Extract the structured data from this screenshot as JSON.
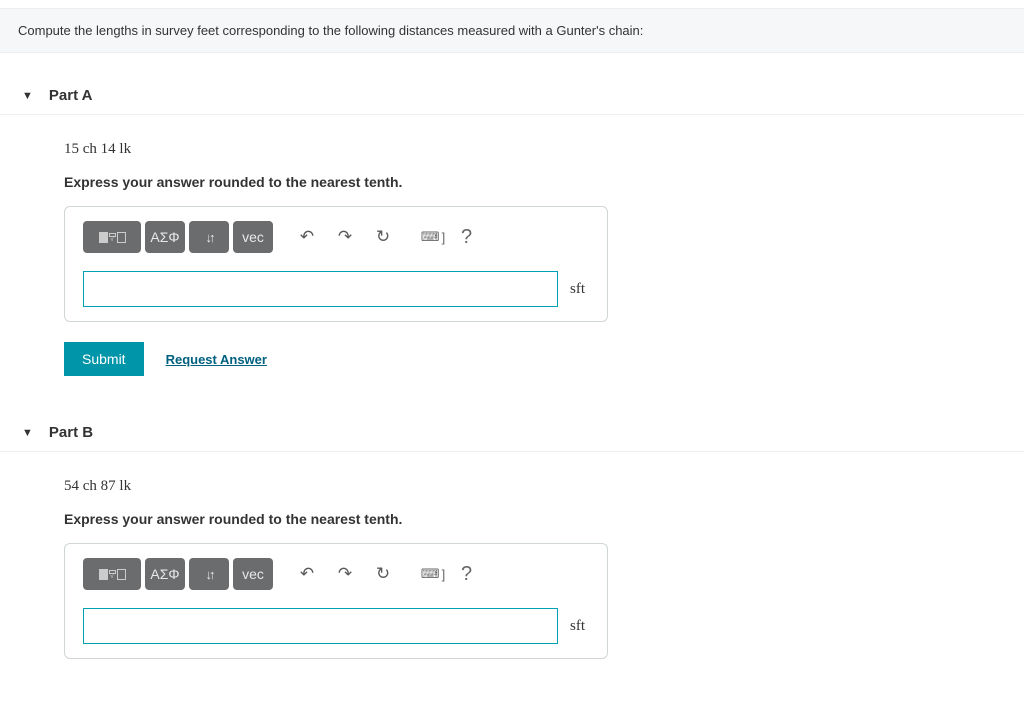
{
  "question": "Compute the lengths in survey feet corresponding to the following distances measured with a Gunter's chain:",
  "parts": {
    "a": {
      "title": "Part A",
      "measurement": "15 ch 14 lk",
      "instruction": "Express your answer rounded to the nearest tenth.",
      "unit": "sft"
    },
    "b": {
      "title": "Part B",
      "measurement": "54 ch 87 lk",
      "instruction": "Express your answer rounded to the nearest tenth.",
      "unit": "sft"
    }
  },
  "toolbar": {
    "greek": "ΑΣΦ",
    "vec": "vec",
    "help": "?"
  },
  "actions": {
    "submit": "Submit",
    "request": "Request Answer"
  }
}
